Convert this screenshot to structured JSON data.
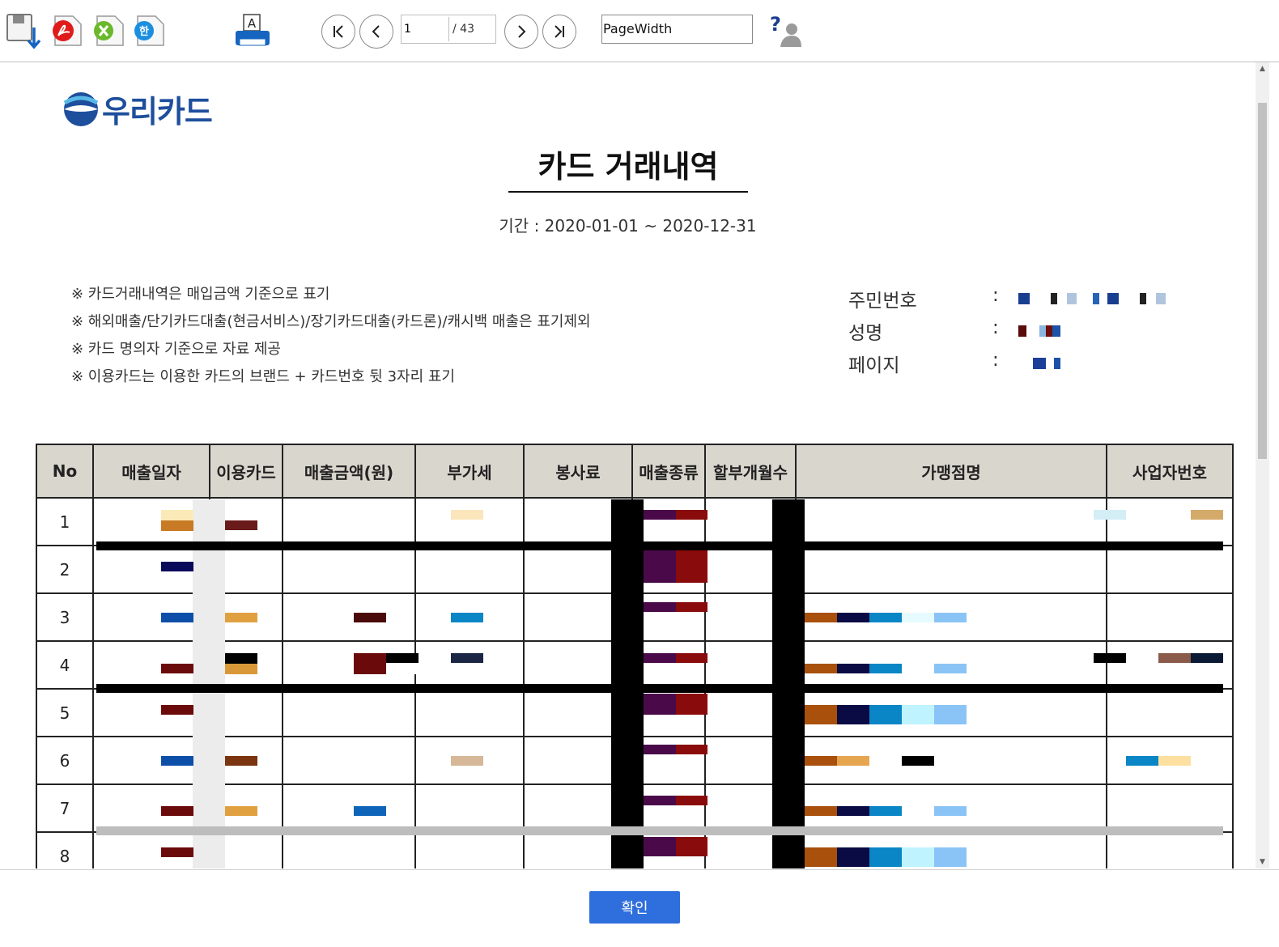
{
  "toolbar": {
    "icons": [
      "save-icon",
      "pdf-export-icon",
      "excel-export-icon",
      "hwp-export-icon",
      "print-icon"
    ],
    "page_input": "1",
    "page_total": "/ 43",
    "zoom_value": "PageWidth",
    "help_icon": "help-icon"
  },
  "document": {
    "logo_text": "우리카드",
    "title": "카드 거래내역",
    "period": "기간 : 2020-01-01 ~ 2020-12-31",
    "notes": [
      "※ 카드거래내역은 매입금액 기준으로 표기",
      "※ 해외매출/단기카드대출(현금서비스)/장기카드대출(카드론)/캐시백 매출은 표기제외",
      "※ 카드 명의자 기준으로 자료 제공",
      "※ 이용카드는 이용한 카드의 브랜드 + 카드번호 뒷 3자리 표기"
    ],
    "info": [
      {
        "label": "주민번호",
        "colon": ":"
      },
      {
        "label": "성명",
        "colon": ":"
      },
      {
        "label": "페이지",
        "colon": ":"
      }
    ]
  },
  "table": {
    "columns": [
      "No",
      "매출일자",
      "이용카드",
      "매출금액(원)",
      "부가세",
      "봉사료",
      "매출종류",
      "할부개월수",
      "가맹점명",
      "사업자번호"
    ],
    "rows": [
      "1",
      "2",
      "3",
      "4",
      "5",
      "6",
      "7",
      "8"
    ]
  },
  "footer": {
    "ok_label": "확인"
  },
  "colors": {
    "accent": "#2f6fdd",
    "header_bg": "#d9d6ce",
    "logo": "#1e4f9c"
  }
}
